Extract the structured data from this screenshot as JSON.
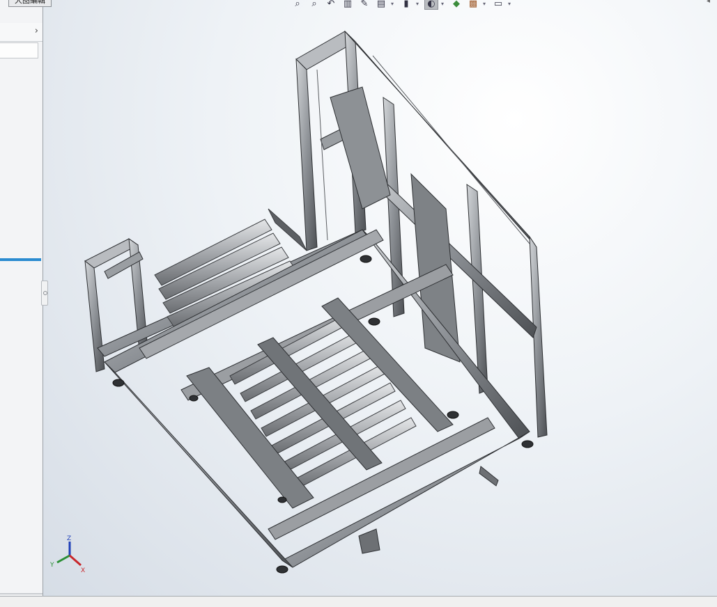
{
  "left_pane": {
    "tab_label": "大图編輯",
    "chevron": "›"
  },
  "toolbar": {
    "icons": [
      "zoom-to-fit-icon",
      "zoom-to-area-icon",
      "previous-view-icon",
      "section-view-icon",
      "dynamic-annotation-icon",
      "view-orientation-icon",
      "display-style-icon",
      "hide-show-items-icon",
      "edit-appearance-icon",
      "apply-scene-icon",
      "view-settings-icon"
    ],
    "glyphs": {
      "zoom_fit": "⌕",
      "zoom_area": "⌕",
      "previous": "↶",
      "section": "▥",
      "annotation": "✎",
      "orientation": "▤",
      "display": "▮",
      "hide_show": "◐",
      "appearance": "◆",
      "scene": "▩",
      "settings": "▭",
      "dropdown": "▾"
    }
  },
  "viewport": {
    "right_edge_glyph": "◂"
  },
  "triad": {
    "x_label": "X",
    "y_label": "Y",
    "z_label": "Z",
    "x_color": "#c8262a",
    "y_color": "#2a8f35",
    "z_color": "#1f3fb8"
  },
  "colors": {
    "accent": "#2a8bd0",
    "model_fill": "#8d9196",
    "model_dark": "#4a4d51",
    "model_light": "#c7cacd"
  }
}
